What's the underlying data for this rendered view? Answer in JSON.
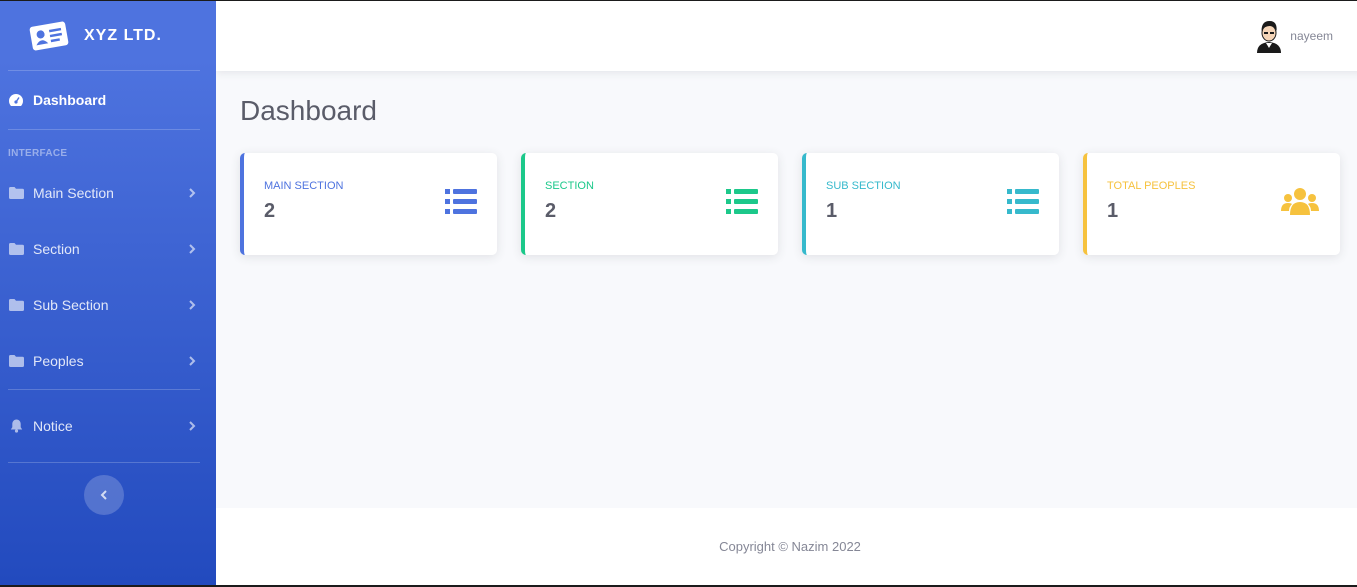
{
  "brand": {
    "name": "XYZ LTD."
  },
  "sidebar": {
    "dashboard_label": "Dashboard",
    "heading": "INTERFACE",
    "items": [
      {
        "label": "Main Section"
      },
      {
        "label": "Section"
      },
      {
        "label": "Sub Section"
      },
      {
        "label": "Peoples"
      }
    ],
    "notice_label": "Notice"
  },
  "topbar": {
    "username": "nayeem"
  },
  "main": {
    "title": "Dashboard",
    "cards": [
      {
        "title": "MAIN SECTION",
        "value": "2",
        "color": "#4e73df",
        "icon": "list-icon"
      },
      {
        "title": "SECTION",
        "value": "2",
        "color": "#1cc88a",
        "icon": "list-icon"
      },
      {
        "title": "SUB SECTION",
        "value": "1",
        "color": "#36b9cc",
        "icon": "list-icon"
      },
      {
        "title": "TOTAL PEOPLES",
        "value": "1",
        "color": "#f6c23e",
        "icon": "users-icon"
      }
    ]
  },
  "footer": {
    "copyright": "Copyright © Nazim 2022"
  }
}
